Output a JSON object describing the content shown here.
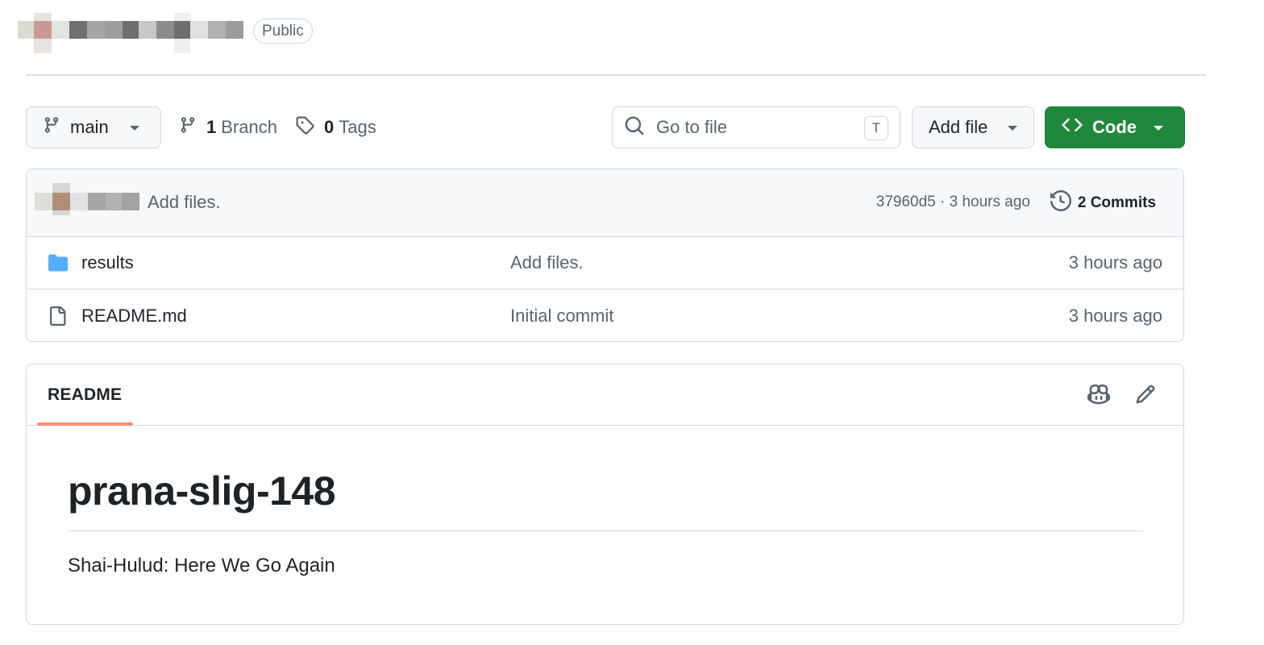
{
  "header": {
    "visibility_badge": "Public"
  },
  "toolbar": {
    "branch_name": "main",
    "branch_count": "1",
    "branch_label": "Branch",
    "tag_count": "0",
    "tag_label": "Tags",
    "search_placeholder": "Go to file",
    "search_shortcut": "T",
    "add_file_label": "Add file",
    "code_label": "Code",
    "code_button_color": "#1f883d"
  },
  "latest_commit": {
    "message": "Add files.",
    "meta": "37960d5 · 3 hours ago",
    "commits_label": "2 Commits"
  },
  "files": [
    {
      "name": "results",
      "type": "folder",
      "icon": "folder-icon",
      "commit_message": "Add files.",
      "time": "3 hours ago"
    },
    {
      "name": "README.md",
      "type": "file",
      "icon": "file-icon",
      "commit_message": "Initial commit",
      "time": "3 hours ago"
    }
  ],
  "readme": {
    "tab_label": "README",
    "title": "prana-slig-148",
    "body": "Shai-Hulud: Here We Go Again",
    "accent_color": "#fd8c73"
  }
}
